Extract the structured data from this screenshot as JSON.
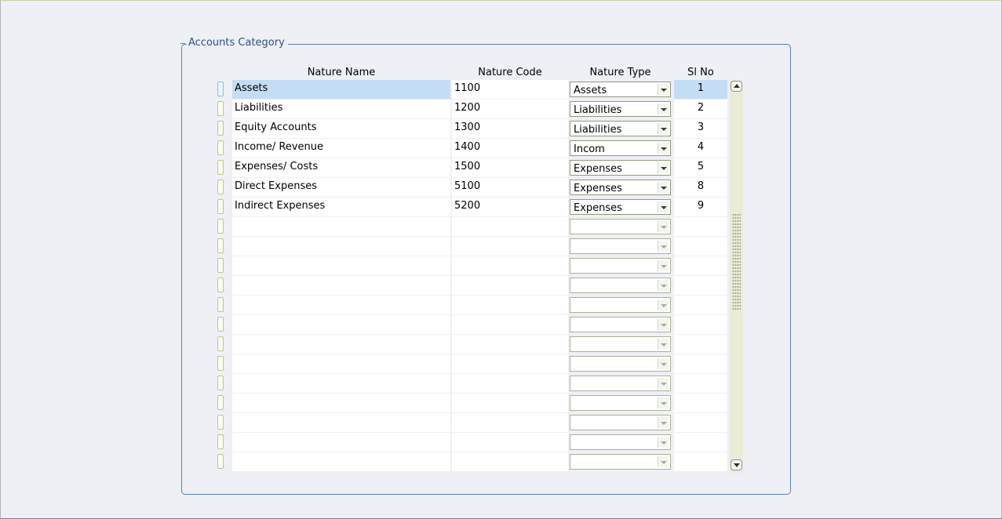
{
  "group_title": "Accounts Category",
  "columns": {
    "name": "Nature Name",
    "code": "Nature Code",
    "type": "Nature Type",
    "sl": "Sl No"
  },
  "rows": [
    {
      "name": "Assets",
      "code": "1100",
      "type": "Assets",
      "sl": "1"
    },
    {
      "name": "Liabilities",
      "code": "1200",
      "type": "Liabilities",
      "sl": "2"
    },
    {
      "name": "Equity Accounts",
      "code": "1300",
      "type": "Liabilities",
      "sl": "3"
    },
    {
      "name": "Income/ Revenue",
      "code": "1400",
      "type": "Incom",
      "sl": "4"
    },
    {
      "name": "Expenses/ Costs",
      "code": "1500",
      "type": "Expenses",
      "sl": "5"
    },
    {
      "name": "Direct Expenses",
      "code": "5100",
      "type": "Expenses",
      "sl": "8"
    },
    {
      "name": "Indirect Expenses",
      "code": "5200",
      "type": "Expenses",
      "sl": "9"
    },
    {
      "name": "",
      "code": "",
      "type": "",
      "sl": ""
    },
    {
      "name": "",
      "code": "",
      "type": "",
      "sl": ""
    },
    {
      "name": "",
      "code": "",
      "type": "",
      "sl": ""
    },
    {
      "name": "",
      "code": "",
      "type": "",
      "sl": ""
    },
    {
      "name": "",
      "code": "",
      "type": "",
      "sl": ""
    },
    {
      "name": "",
      "code": "",
      "type": "",
      "sl": ""
    },
    {
      "name": "",
      "code": "",
      "type": "",
      "sl": ""
    },
    {
      "name": "",
      "code": "",
      "type": "",
      "sl": ""
    },
    {
      "name": "",
      "code": "",
      "type": "",
      "sl": ""
    },
    {
      "name": "",
      "code": "",
      "type": "",
      "sl": ""
    },
    {
      "name": "",
      "code": "",
      "type": "",
      "sl": ""
    },
    {
      "name": "",
      "code": "",
      "type": "",
      "sl": ""
    },
    {
      "name": "",
      "code": "",
      "type": "",
      "sl": ""
    }
  ],
  "selected_row": 1
}
